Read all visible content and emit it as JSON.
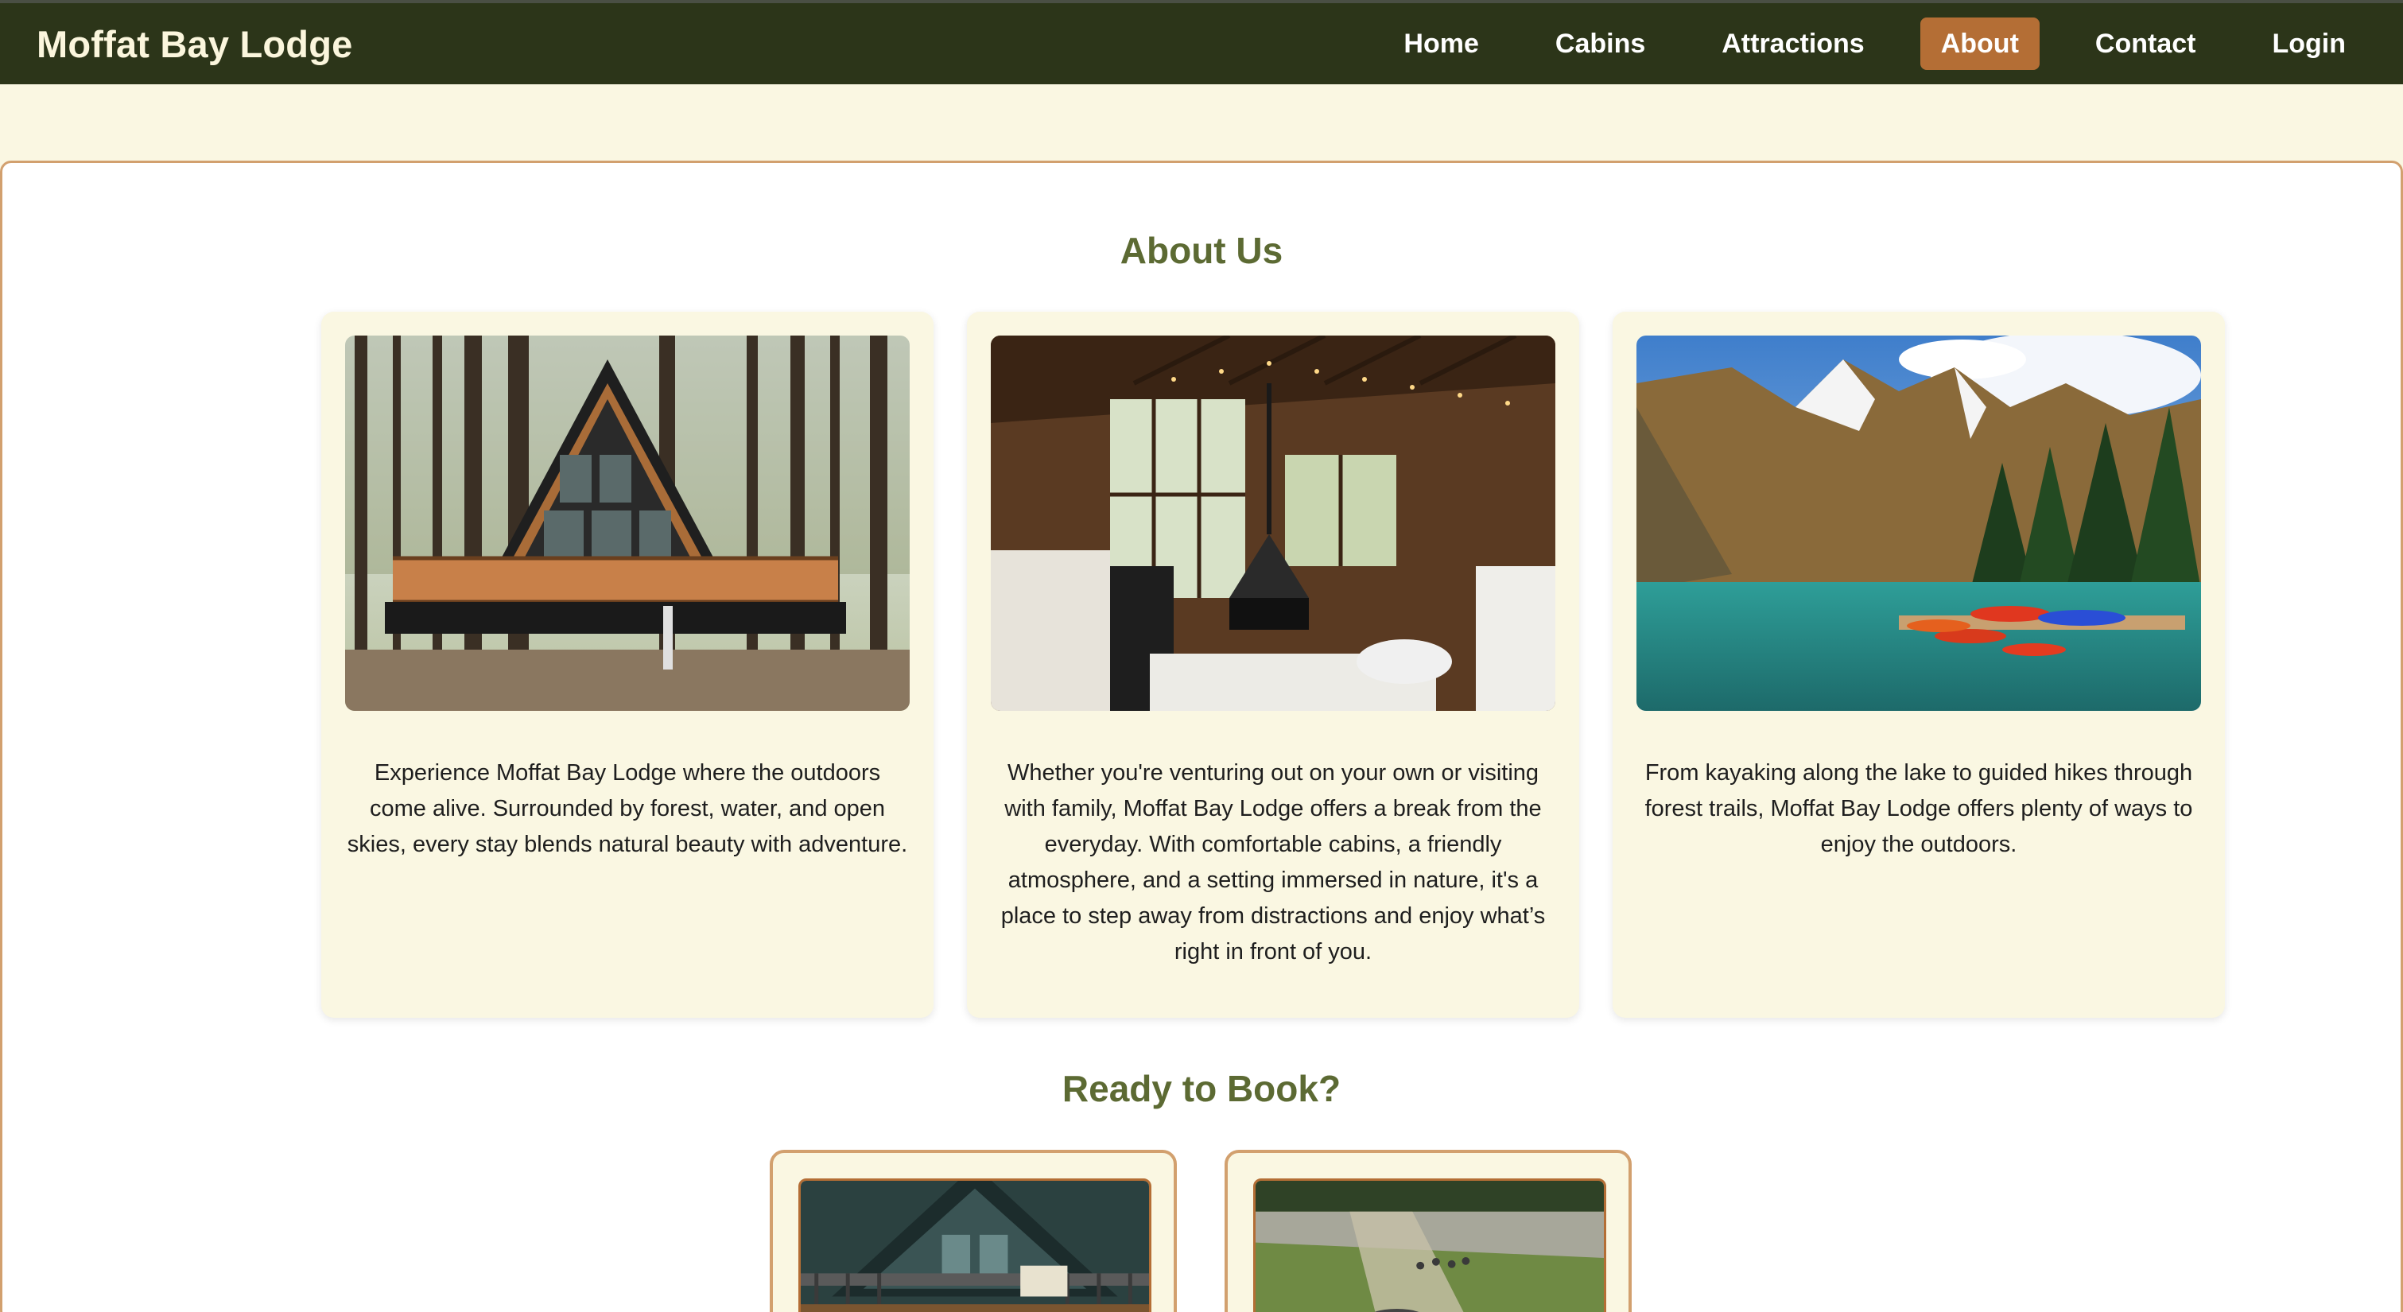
{
  "nav": {
    "brand": "Moffat Bay Lodge",
    "links": [
      "Home",
      "Cabins",
      "Attractions",
      "About",
      "Contact",
      "Login"
    ],
    "active": "About"
  },
  "about": {
    "title": "About Us",
    "cards": [
      {
        "image": "a-frame-cabin-in-forest",
        "text": "Experience Moffat Bay Lodge where the outdoors come alive. Surrounded by forest, water, and open skies, every stay blends natural beauty with adventure."
      },
      {
        "image": "cabin-interior-with-fireplace",
        "text": "Whether you're venturing out on your own or visiting with family, Moffat Bay Lodge offers a break from the everyday. With comfortable cabins, a friendly atmosphere, and a setting immersed in nature, it's a place to step away from distractions and enjoy what’s right in front of you."
      },
      {
        "image": "mountain-lake-with-canoes",
        "text": "From kayaking along the lake to guided hikes through forest trails, Moffat Bay Lodge offers plenty of ways to enjoy the outdoors."
      }
    ]
  },
  "booking": {
    "title": "Ready to Book?",
    "cards": [
      {
        "image": "a-frame-cabin-deck"
      },
      {
        "image": "hikers-on-mountain-trail"
      }
    ]
  },
  "colors": {
    "nav_bg": "#2c3519",
    "accent": "#b46e35",
    "heading": "#5c6a33",
    "page_bg": "#faf7e2",
    "panel_border": "#d2a06e"
  }
}
